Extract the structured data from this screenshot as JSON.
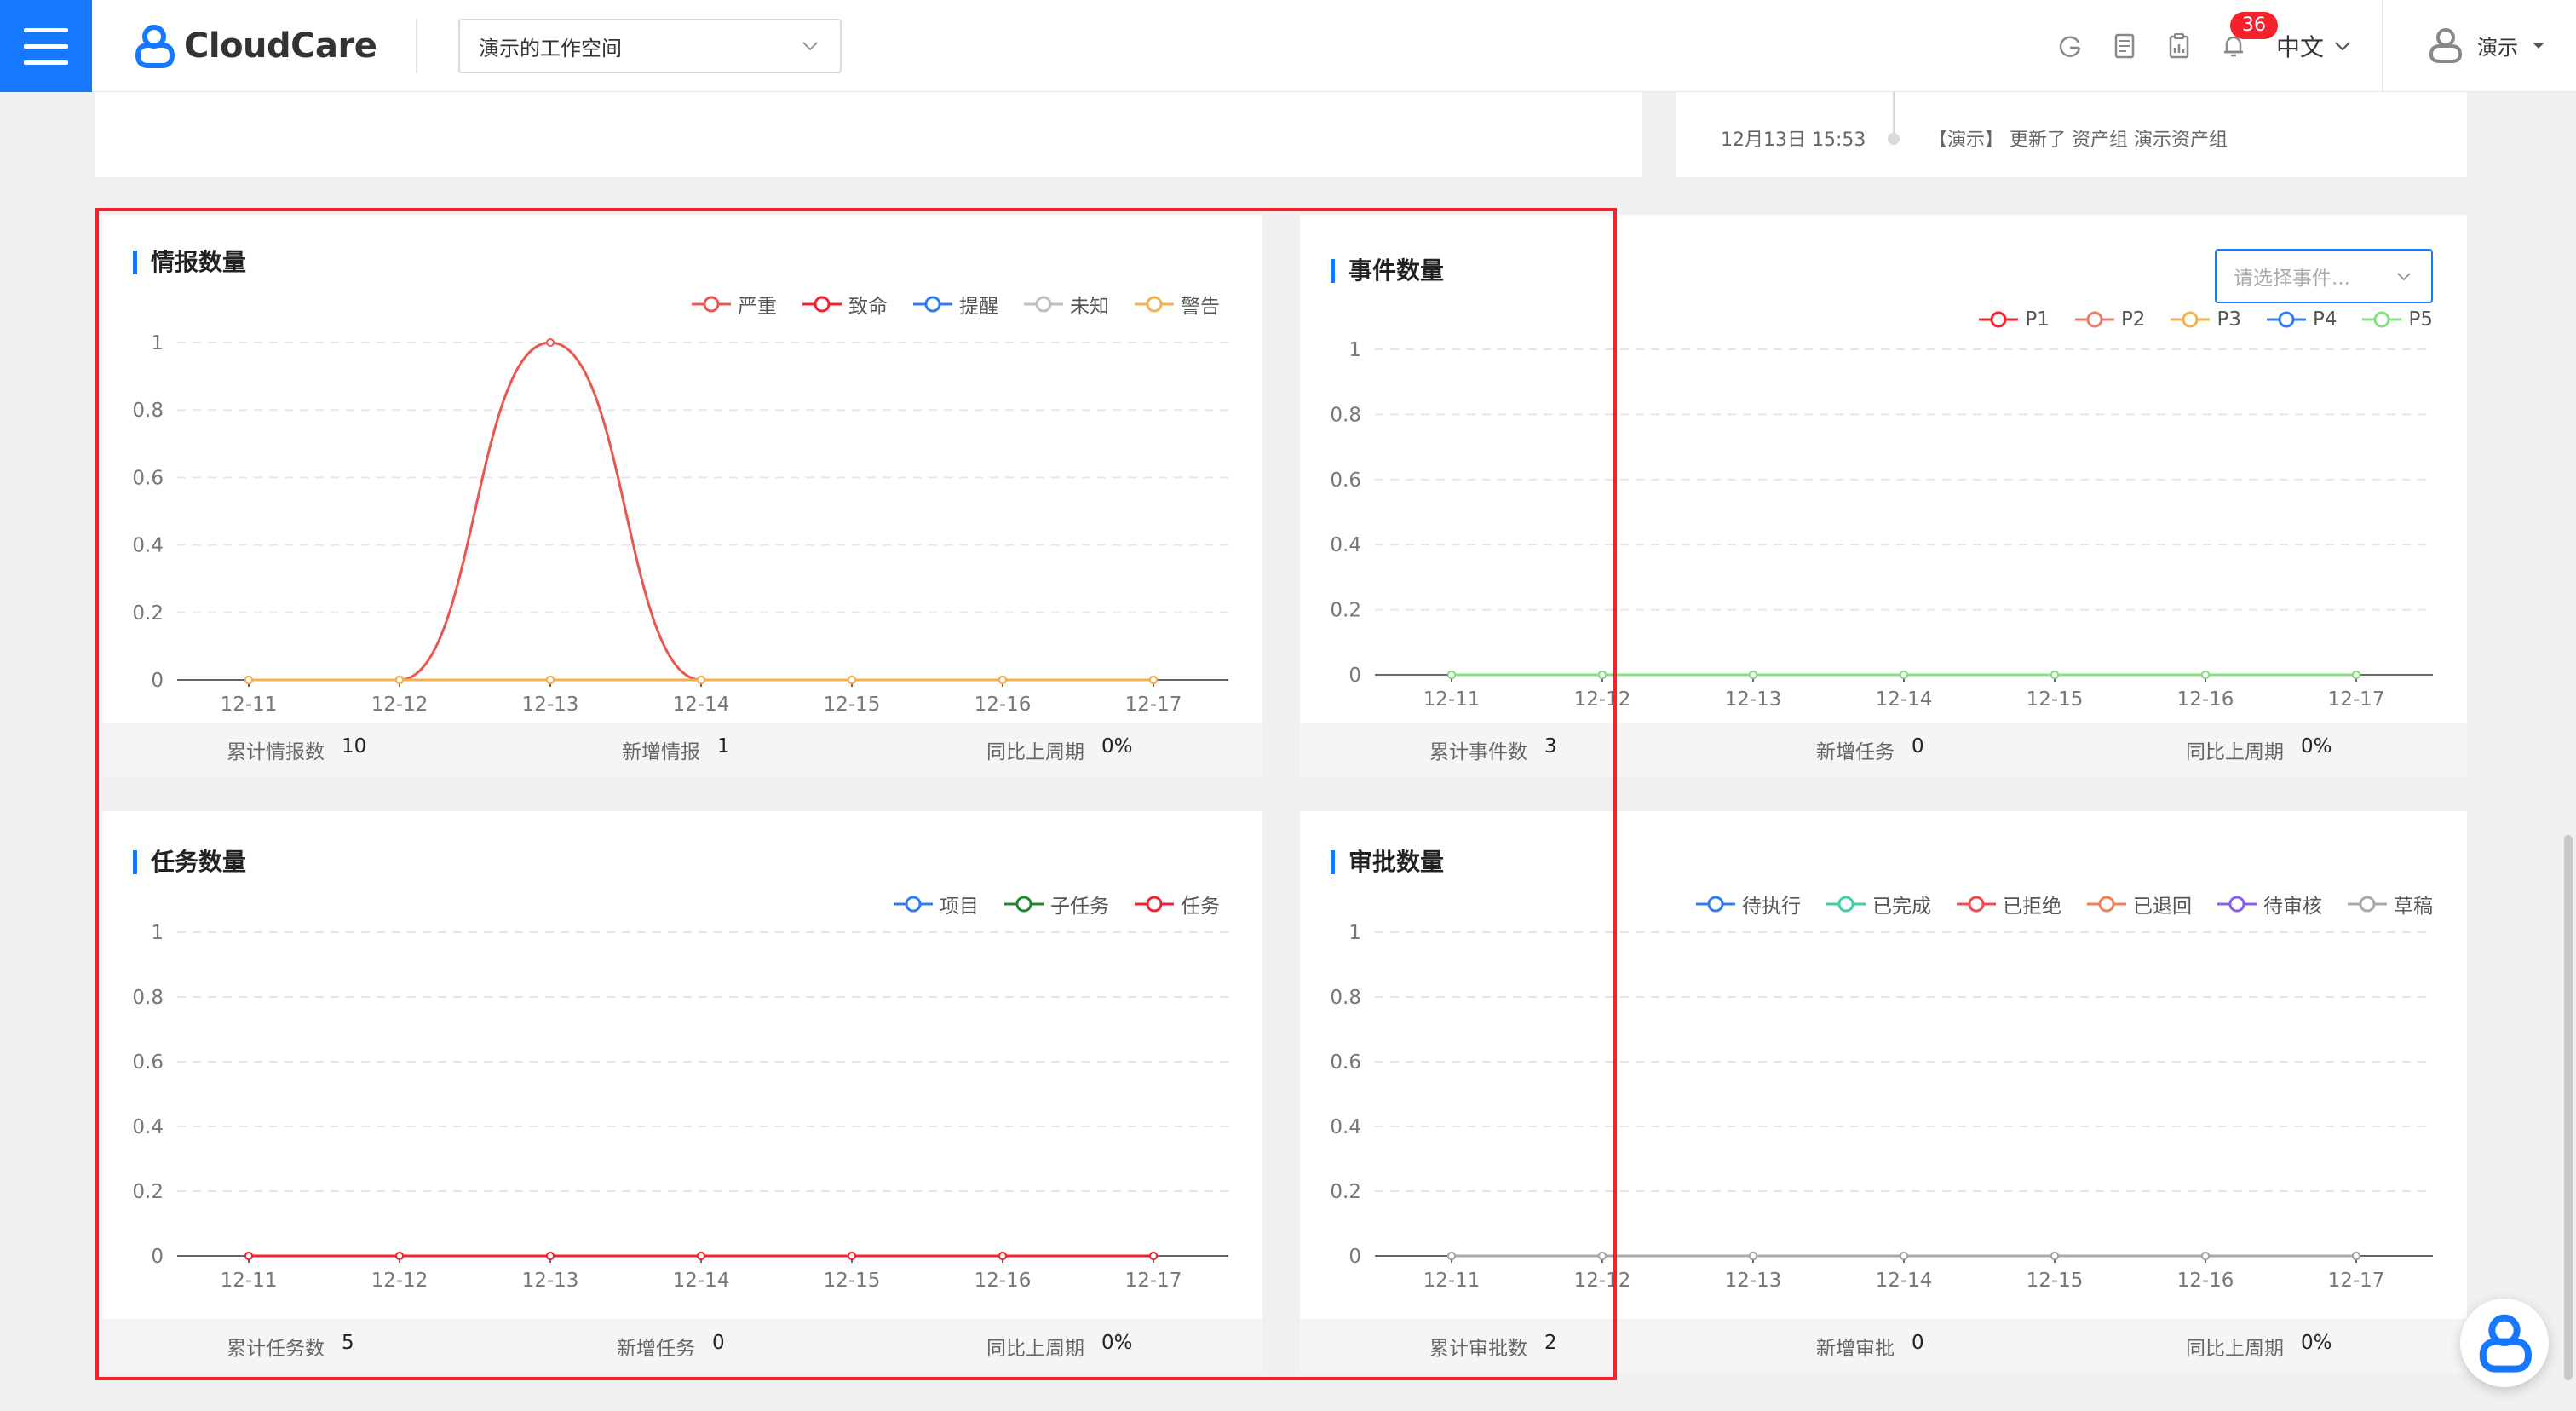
{
  "header": {
    "logo_text": "CloudCare",
    "workspace": "演示的工作空间",
    "notification_count": "36",
    "language": "中文",
    "user_name": "演示"
  },
  "top_panel": {
    "timeline_time": "12月13日 15:53",
    "timeline_text": "【演示】 更新了 资产组 演示资产组"
  },
  "colors": {
    "accent": "#1677ff",
    "highlight_frame": "#f5222d"
  },
  "cards": {
    "intel": {
      "title": "情报数量",
      "stats": [
        {
          "label": "累计情报数",
          "value": "10"
        },
        {
          "label": "新增情报",
          "value": "1"
        },
        {
          "label": "同比上周期",
          "value": "0%"
        }
      ]
    },
    "event": {
      "title": "事件数量",
      "select_placeholder": "请选择事件...",
      "stats": [
        {
          "label": "累计事件数",
          "value": "3"
        },
        {
          "label": "新增任务",
          "value": "0"
        },
        {
          "label": "同比上周期",
          "value": "0%"
        }
      ]
    },
    "task": {
      "title": "任务数量",
      "stats": [
        {
          "label": "累计任务数",
          "value": "5"
        },
        {
          "label": "新增任务",
          "value": "0"
        },
        {
          "label": "同比上周期",
          "value": "0%"
        }
      ]
    },
    "approval": {
      "title": "审批数量",
      "stats": [
        {
          "label": "累计审批数",
          "value": "2"
        },
        {
          "label": "新增审批",
          "value": "0"
        },
        {
          "label": "同比上周期",
          "value": "0%"
        }
      ]
    }
  },
  "chart_data": [
    {
      "type": "line",
      "title": "情报数量",
      "x": [
        "12-11",
        "12-12",
        "12-13",
        "12-14",
        "12-15",
        "12-16",
        "12-17"
      ],
      "ylim": [
        0,
        1
      ],
      "yticks": [
        "0",
        "0.2",
        "0.4",
        "0.6",
        "0.8",
        "1"
      ],
      "legend_placement": "top-right",
      "series": [
        {
          "name": "严重",
          "color": "#e8584f",
          "values": [
            0,
            0,
            1,
            0,
            0,
            0,
            0
          ]
        },
        {
          "name": "致命",
          "color": "#f5222d",
          "values": [
            0,
            0,
            0,
            0,
            0,
            0,
            0
          ]
        },
        {
          "name": "提醒",
          "color": "#2f7bf6",
          "values": [
            0,
            0,
            0,
            0,
            0,
            0,
            0
          ]
        },
        {
          "name": "未知",
          "color": "#bfbfbf",
          "values": [
            0,
            0,
            0,
            0,
            0,
            0,
            0
          ]
        },
        {
          "name": "警告",
          "color": "#f5b04b",
          "values": [
            0,
            0,
            0,
            0,
            0,
            0,
            0
          ]
        }
      ]
    },
    {
      "type": "line",
      "title": "事件数量",
      "x": [
        "12-11",
        "12-12",
        "12-13",
        "12-14",
        "12-15",
        "12-16",
        "12-17"
      ],
      "ylim": [
        0,
        1
      ],
      "yticks": [
        "0",
        "0.2",
        "0.4",
        "0.6",
        "0.8",
        "1"
      ],
      "legend_placement": "top-right",
      "series": [
        {
          "name": "P1",
          "color": "#f5222d",
          "values": [
            0,
            0,
            0,
            0,
            0,
            0,
            0
          ]
        },
        {
          "name": "P2",
          "color": "#ec7a6a",
          "values": [
            0,
            0,
            0,
            0,
            0,
            0,
            0
          ]
        },
        {
          "name": "P3",
          "color": "#f5b04b",
          "values": [
            0,
            0,
            0,
            0,
            0,
            0,
            0
          ]
        },
        {
          "name": "P4",
          "color": "#2f7bf6",
          "values": [
            0,
            0,
            0,
            0,
            0,
            0,
            0
          ]
        },
        {
          "name": "P5",
          "color": "#86e07f",
          "values": [
            0,
            0,
            0,
            0,
            0,
            0,
            0
          ]
        }
      ]
    },
    {
      "type": "line",
      "title": "任务数量",
      "x": [
        "12-11",
        "12-12",
        "12-13",
        "12-14",
        "12-15",
        "12-16",
        "12-17"
      ],
      "ylim": [
        0,
        1
      ],
      "yticks": [
        "0",
        "0.2",
        "0.4",
        "0.6",
        "0.8",
        "1"
      ],
      "legend_placement": "top-right",
      "series": [
        {
          "name": "项目",
          "color": "#2f7bf6",
          "values": [
            0,
            0,
            0,
            0,
            0,
            0,
            0
          ]
        },
        {
          "name": "子任务",
          "color": "#1e8a2e",
          "values": [
            0,
            0,
            0,
            0,
            0,
            0,
            0
          ]
        },
        {
          "name": "任务",
          "color": "#f5222d",
          "values": [
            0,
            0,
            0,
            0,
            0,
            0,
            0
          ]
        }
      ]
    },
    {
      "type": "line",
      "title": "审批数量",
      "x": [
        "12-11",
        "12-12",
        "12-13",
        "12-14",
        "12-15",
        "12-16",
        "12-17"
      ],
      "ylim": [
        0,
        1
      ],
      "yticks": [
        "0",
        "0.2",
        "0.4",
        "0.6",
        "0.8",
        "1"
      ],
      "legend_placement": "top-right",
      "series": [
        {
          "name": "待执行",
          "color": "#2f7bf6",
          "values": [
            0,
            0,
            0,
            0,
            0,
            0,
            0
          ]
        },
        {
          "name": "已完成",
          "color": "#3ccfa8",
          "values": [
            0,
            0,
            0,
            0,
            0,
            0,
            0
          ]
        },
        {
          "name": "已拒绝",
          "color": "#f04a4a",
          "values": [
            0,
            0,
            0,
            0,
            0,
            0,
            0
          ]
        },
        {
          "name": "已退回",
          "color": "#f08055",
          "values": [
            0,
            0,
            0,
            0,
            0,
            0,
            0
          ]
        },
        {
          "name": "待审核",
          "color": "#8a5cf5",
          "values": [
            0,
            0,
            0,
            0,
            0,
            0,
            0
          ]
        },
        {
          "name": "草稿",
          "color": "#a8a8a8",
          "values": [
            0,
            0,
            0,
            0,
            0,
            0,
            0
          ]
        }
      ]
    }
  ]
}
